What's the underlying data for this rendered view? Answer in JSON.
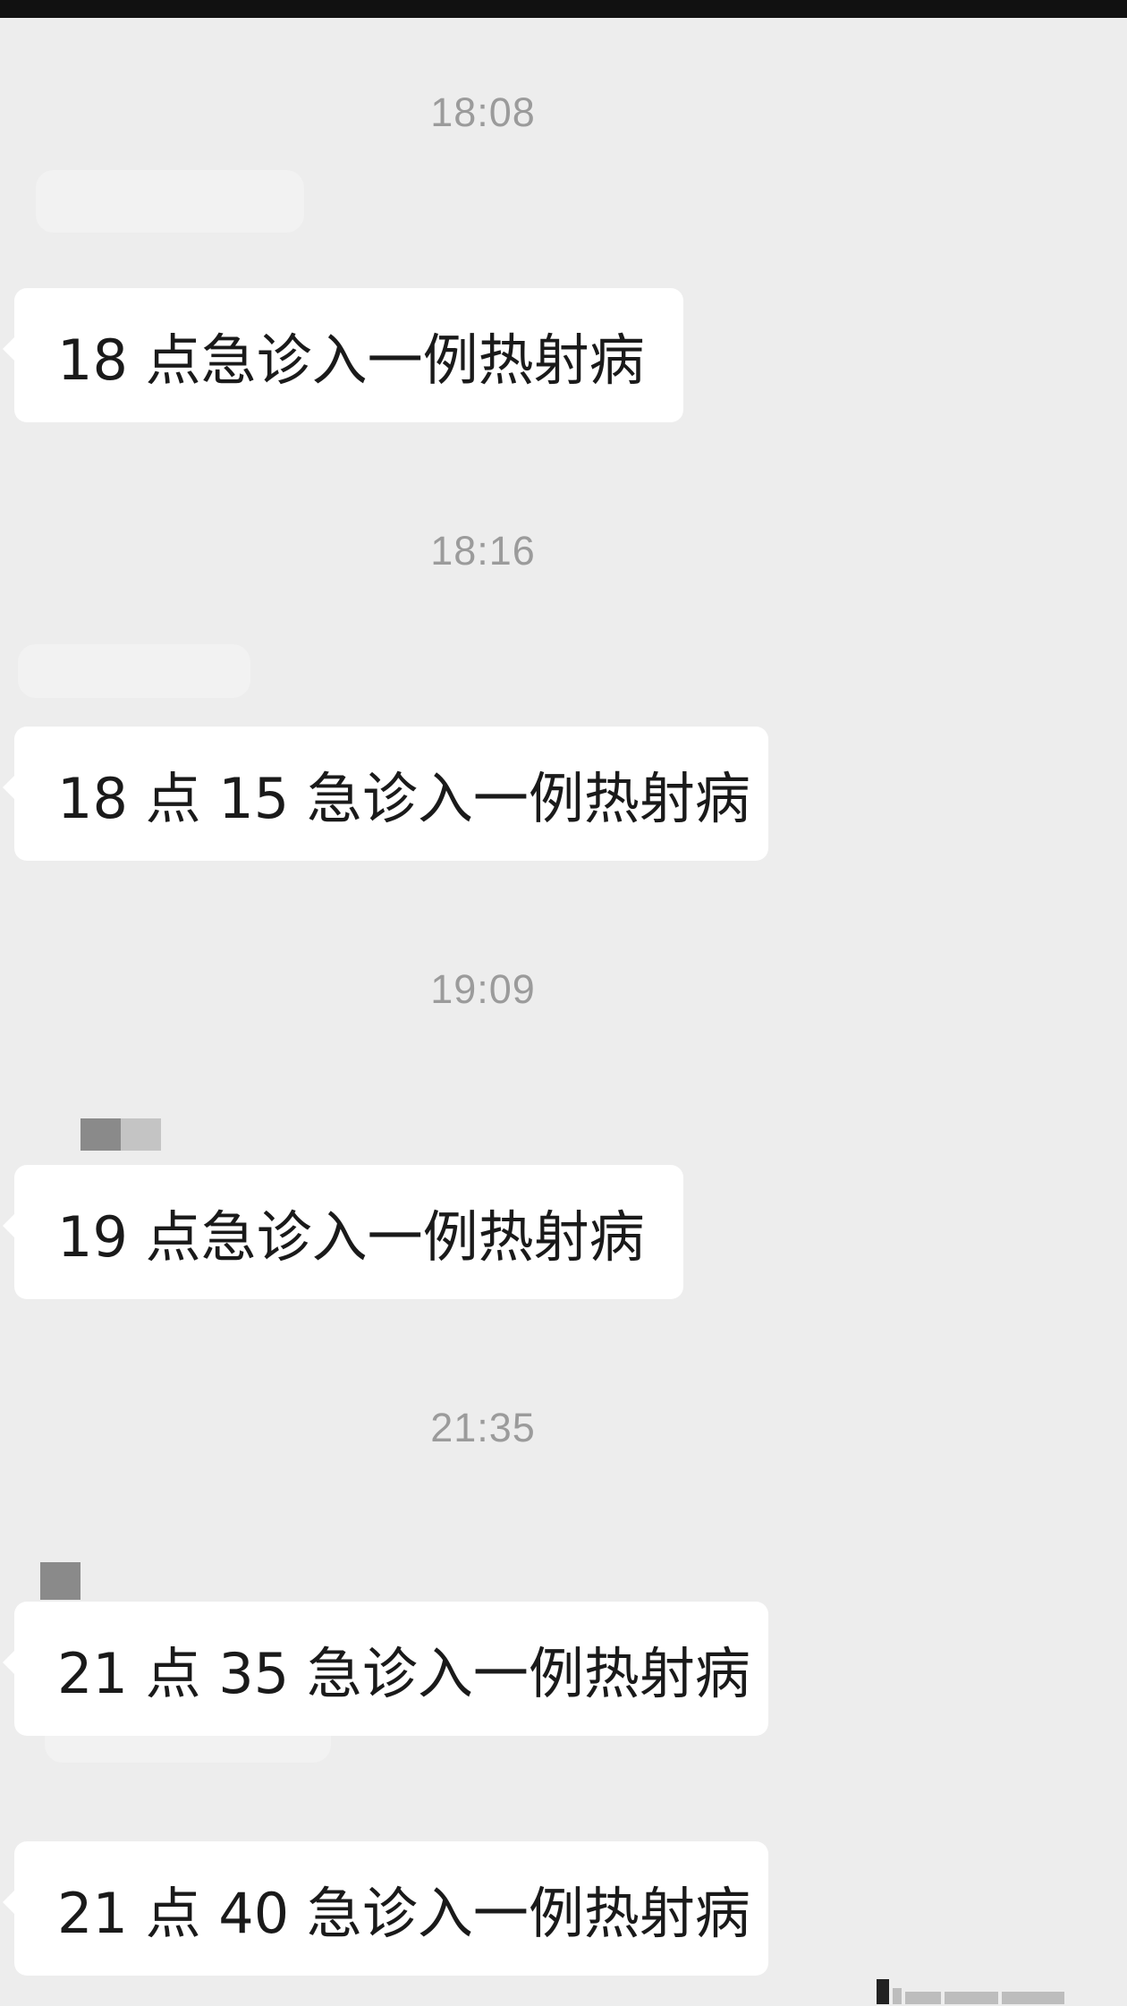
{
  "chat": {
    "messages": [
      {
        "time": "18:08",
        "text": "18 点急诊入一例热射病"
      },
      {
        "time": "18:16",
        "text": "18 点 15 急诊入一例热射病"
      },
      {
        "time": "19:09",
        "text": "19 点急诊入一例热射病"
      },
      {
        "time": "21:35",
        "text": "21 点 35 急诊入一例热射病"
      },
      {
        "time": "",
        "text": "21 点 40 急诊入一例热射病"
      }
    ]
  },
  "colors": {
    "background": "#ededed",
    "bubble": "#ffffff",
    "timestamp": "#9b9b9b",
    "text": "#1a1a1a"
  }
}
